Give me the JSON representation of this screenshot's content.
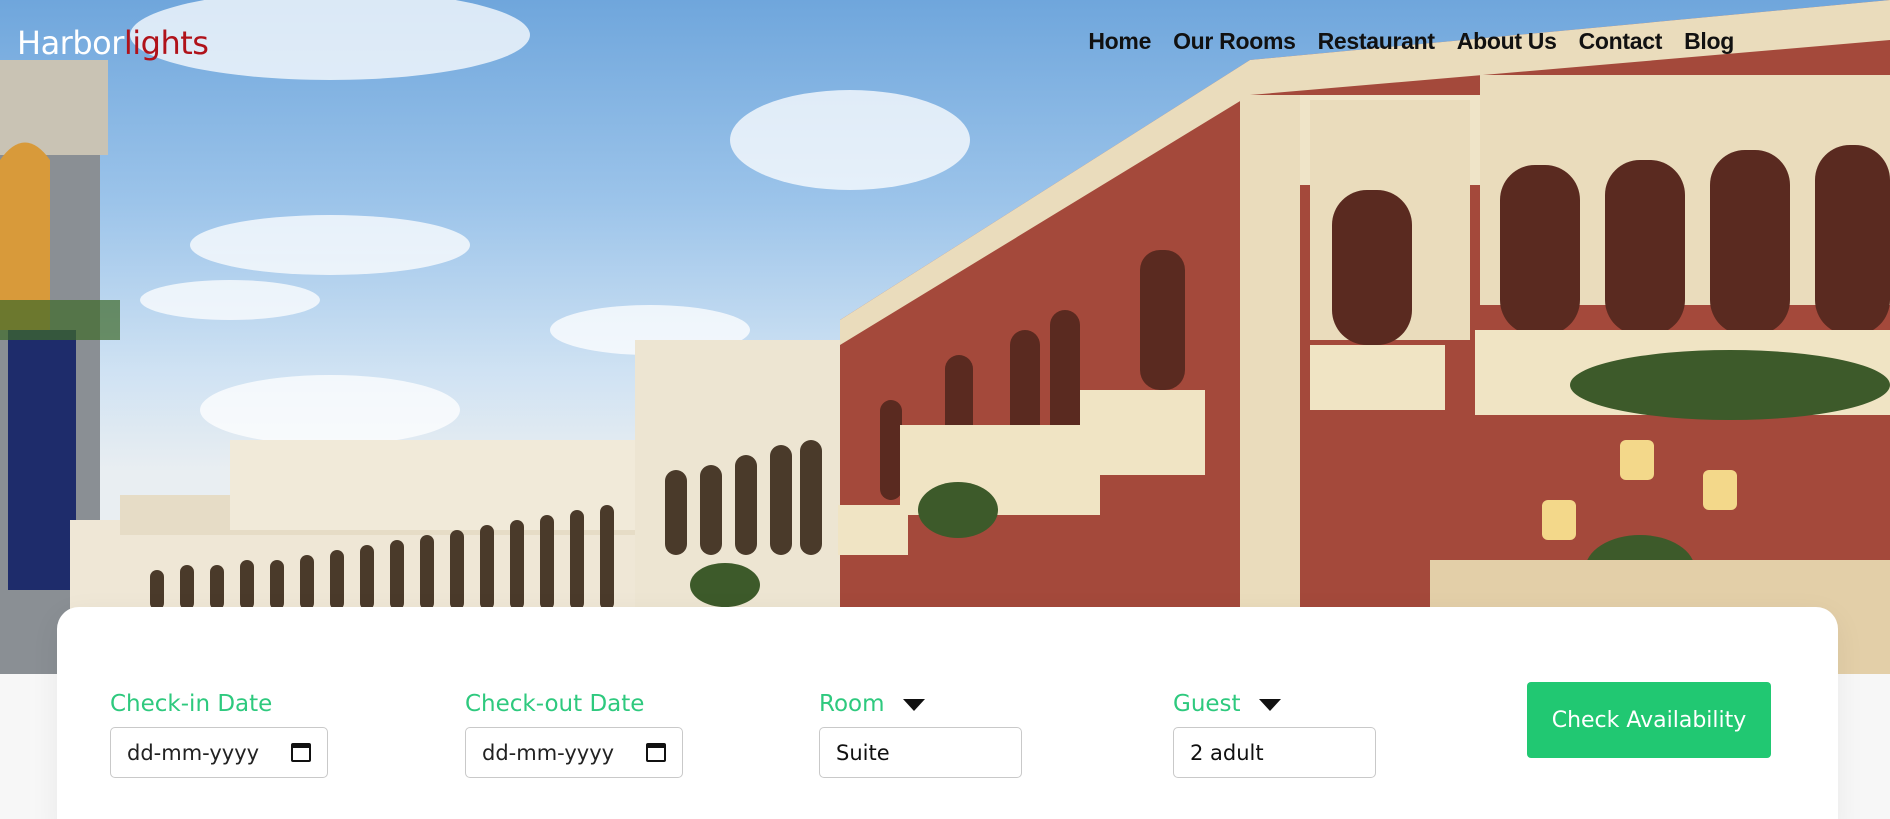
{
  "logo": {
    "part1": "Harbor",
    "part2": "lights"
  },
  "nav": [
    {
      "label": "Home"
    },
    {
      "label": "Our Rooms"
    },
    {
      "label": "Restaurant"
    },
    {
      "label": "About Us"
    },
    {
      "label": "Contact"
    },
    {
      "label": "Blog"
    }
  ],
  "booking": {
    "checkin": {
      "label": "Check-in Date",
      "placeholder": "dd-mm-yyyy"
    },
    "checkout": {
      "label": "Check-out Date",
      "placeholder": "dd-mm-yyyy"
    },
    "room": {
      "label": "Room",
      "value": "Suite"
    },
    "guest": {
      "label": "Guest",
      "value": "2 adult"
    },
    "button": "Check Availability"
  },
  "colors": {
    "accent": "#21c872",
    "logo_accent": "#b0121a",
    "label": "#2ec97e"
  }
}
